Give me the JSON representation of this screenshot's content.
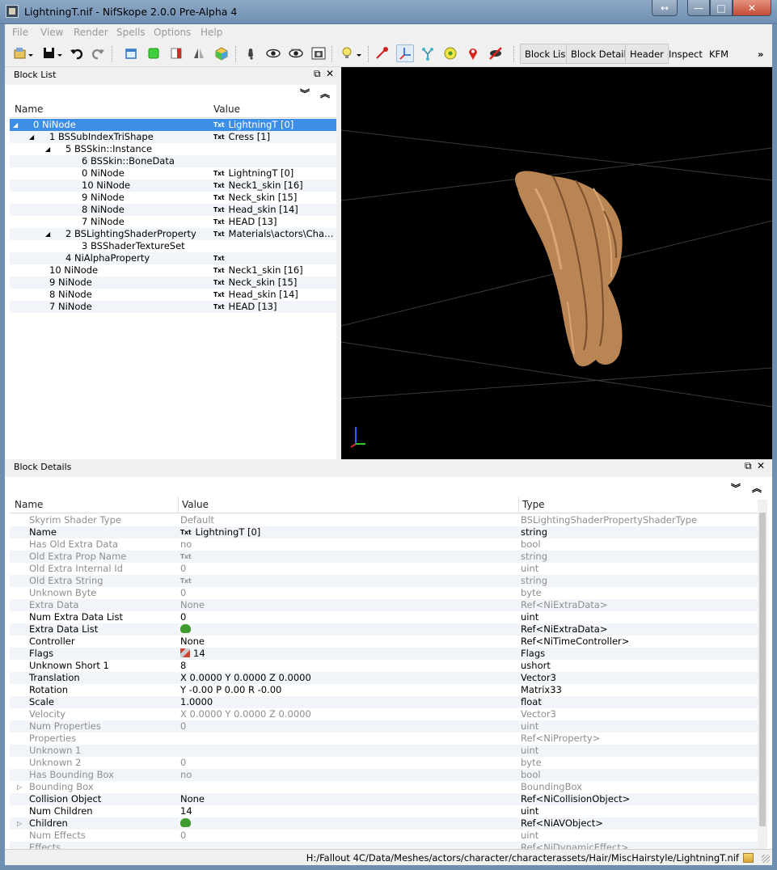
{
  "window": {
    "title": "LightningT.nif - NifSkope 2.0.0 Pre-Alpha 4",
    "controls": {
      "resize": "↔",
      "minimize": "—",
      "maximize": "□",
      "close": "✕"
    }
  },
  "menu": [
    "File",
    "View",
    "Render",
    "Spells",
    "Options",
    "Help"
  ],
  "toolbar": {
    "icons": [
      "open-icon",
      "save-icon",
      "undo-icon",
      "redo-icon",
      "view-top-icon",
      "view-front-icon",
      "view-side-icon",
      "view-walk-icon",
      "view-user-icon",
      "show-hidden-icon",
      "show-eye-icon",
      "show-eye2-icon",
      "screenshot-icon",
      "light-icon",
      "select-icon",
      "axes-icon",
      "nodes-icon",
      "collision-icon",
      "marker-icon",
      "hide-icon"
    ],
    "toggles": {
      "block_list": "Block List",
      "block_details": "Block Details",
      "header": "Header",
      "inspect": "Inspect",
      "kfm": "KFM",
      "more": "»"
    }
  },
  "block_list": {
    "title": "Block List",
    "columns": {
      "name": "Name",
      "value": "Value"
    },
    "rows": [
      {
        "indent": 0,
        "expand": "◢",
        "name": "0 NiNode",
        "txt": "Txt",
        "value": "LightningT [0]",
        "selected": true
      },
      {
        "indent": 1,
        "expand": "◢",
        "name": "1 BSSubIndexTriShape",
        "txt": "Txt",
        "value": "Cress [1]"
      },
      {
        "indent": 2,
        "expand": "◢",
        "name": "5 BSSkin::Instance",
        "txt": "",
        "value": ""
      },
      {
        "indent": 3,
        "expand": "",
        "name": "6 BSSkin::BoneData",
        "txt": "",
        "value": ""
      },
      {
        "indent": 3,
        "expand": "",
        "name": "0 NiNode",
        "txt": "Txt",
        "value": "LightningT [0]"
      },
      {
        "indent": 3,
        "expand": "",
        "name": "10 NiNode",
        "txt": "Txt",
        "value": "Neck1_skin [16]"
      },
      {
        "indent": 3,
        "expand": "",
        "name": "9 NiNode",
        "txt": "Txt",
        "value": "Neck_skin [15]"
      },
      {
        "indent": 3,
        "expand": "",
        "name": "8 NiNode",
        "txt": "Txt",
        "value": "Head_skin [14]"
      },
      {
        "indent": 3,
        "expand": "",
        "name": "7 NiNode",
        "txt": "Txt",
        "value": "HEAD [13]"
      },
      {
        "indent": 2,
        "expand": "◢",
        "name": "2 BSLightingShaderProperty",
        "txt": "Txt",
        "value": "Materials\\actors\\Chara..."
      },
      {
        "indent": 3,
        "expand": "",
        "name": "3 BSShaderTextureSet",
        "txt": "",
        "value": ""
      },
      {
        "indent": 2,
        "expand": "",
        "name": "4 NiAlphaProperty",
        "txt": "Txt",
        "value": ""
      },
      {
        "indent": 1,
        "expand": "",
        "name": "10 NiNode",
        "txt": "Txt",
        "value": "Neck1_skin [16]"
      },
      {
        "indent": 1,
        "expand": "",
        "name": "9 NiNode",
        "txt": "Txt",
        "value": "Neck_skin [15]"
      },
      {
        "indent": 1,
        "expand": "",
        "name": "8 NiNode",
        "txt": "Txt",
        "value": "Head_skin [14]"
      },
      {
        "indent": 1,
        "expand": "",
        "name": "7 NiNode",
        "txt": "Txt",
        "value": "HEAD [13]"
      }
    ]
  },
  "block_details": {
    "title": "Block Details",
    "columns": {
      "name": "Name",
      "value": "Value",
      "type": "Type"
    },
    "rows": [
      {
        "name": "Skyrim Shader Type",
        "value": "Default",
        "type": "BSLightingShaderPropertyShaderType",
        "disabled": true
      },
      {
        "name": "Name",
        "icon": "txt",
        "value": "LightningT [0]",
        "type": "string"
      },
      {
        "name": "Has Old Extra Data",
        "value": "no",
        "type": "bool",
        "disabled": true
      },
      {
        "name": "Old Extra Prop Name",
        "icon": "txt",
        "value": "",
        "type": "string",
        "disabled": true
      },
      {
        "name": "Old Extra Internal Id",
        "value": "0",
        "type": "uint",
        "disabled": true
      },
      {
        "name": "Old Extra String",
        "icon": "txt",
        "value": "",
        "type": "string",
        "disabled": true
      },
      {
        "name": "Unknown Byte",
        "value": "0",
        "type": "byte",
        "disabled": true
      },
      {
        "name": "Extra Data",
        "value": "None",
        "type": "Ref<NiExtraData>",
        "disabled": true
      },
      {
        "name": "Num Extra Data List",
        "value": "0",
        "type": "uint"
      },
      {
        "name": "Extra Data List",
        "icon": "ref",
        "value": "",
        "type": "Ref<NiExtraData>"
      },
      {
        "name": "Controller",
        "value": "None",
        "type": "Ref<NiTimeController>"
      },
      {
        "name": "Flags",
        "icon": "flag",
        "value": "14",
        "type": "Flags"
      },
      {
        "name": "Unknown Short 1",
        "value": "8",
        "type": "ushort"
      },
      {
        "name": "Translation",
        "value": "X 0.0000 Y 0.0000 Z 0.0000",
        "type": "Vector3"
      },
      {
        "name": "Rotation",
        "value": "Y -0.00 P 0.00 R -0.00",
        "type": "Matrix33"
      },
      {
        "name": "Scale",
        "value": "1.0000",
        "type": "float"
      },
      {
        "name": "Velocity",
        "value": "X 0.0000 Y 0.0000 Z 0.0000",
        "type": "Vector3",
        "disabled": true
      },
      {
        "name": "Num Properties",
        "value": "0",
        "type": "uint",
        "disabled": true
      },
      {
        "name": "Properties",
        "value": "",
        "type": "Ref<NiProperty>",
        "disabled": true
      },
      {
        "name": "Unknown 1",
        "value": "",
        "type": "uint",
        "disabled": true
      },
      {
        "name": "Unknown 2",
        "value": "0",
        "type": "byte",
        "disabled": true
      },
      {
        "name": "Has Bounding Box",
        "value": "no",
        "type": "bool",
        "disabled": true
      },
      {
        "name": "Bounding Box",
        "expand": "▷",
        "value": "",
        "type": "BoundingBox",
        "disabled": true
      },
      {
        "name": "Collision Object",
        "value": "None",
        "type": "Ref<NiCollisionObject>"
      },
      {
        "name": "Num Children",
        "value": "14",
        "type": "uint"
      },
      {
        "name": "Children",
        "expand": "▷",
        "icon": "ref",
        "value": "",
        "type": "Ref<NiAVObject>"
      },
      {
        "name": "Num Effects",
        "value": "0",
        "type": "uint",
        "disabled": true
      },
      {
        "name": "Effects",
        "value": "",
        "type": "Ref<NiDynamicEffect>",
        "disabled": true
      }
    ]
  },
  "status_bar": {
    "path": "H:/Fallout 4C/Data/Meshes/actors/character/characterassets/Hair/MiscHairstyle/LightningT.nif"
  },
  "colors": {
    "selection": "#3d8ee6",
    "viewport_bg": "#000000",
    "hair": "#c08b5c"
  }
}
